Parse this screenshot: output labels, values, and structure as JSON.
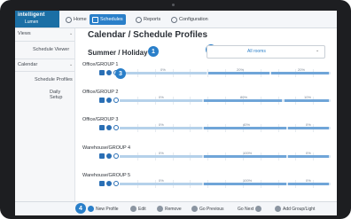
{
  "app": {
    "logo_line1": "intelligent",
    "logo_line2": "Lumen"
  },
  "nav": [
    {
      "label": "Home",
      "icon": "home-icon",
      "active": false
    },
    {
      "label": "Schedules",
      "icon": "calendar-icon",
      "active": true
    },
    {
      "label": "Reports",
      "icon": "reports-icon",
      "active": false
    },
    {
      "label": "Configuration",
      "icon": "gear-icon",
      "active": false
    }
  ],
  "sidebar": {
    "views_label": "Views",
    "schedule_viewer": "Schedule Viewer",
    "calendar_label": "Calendar",
    "schedule_profiles": "Schedule Profiles",
    "daily_setup": "Daily Setup"
  },
  "main": {
    "title": "Calendar / Schedule Profiles",
    "subtitle": "Summer / Holiday",
    "room_select": "All rooms",
    "callouts": [
      "1",
      "2",
      "3",
      "4"
    ]
  },
  "groups": [
    {
      "name": "Office/GROUP 1",
      "segments": [
        {
          "start": 0.0,
          "end": 0.42,
          "level": "0%"
        },
        {
          "start": 0.42,
          "end": 0.72,
          "level": "20%"
        },
        {
          "start": 0.72,
          "end": 1.0,
          "level": "20%"
        }
      ]
    },
    {
      "name": "Office/GROUP 2",
      "segments": [
        {
          "start": 0.0,
          "end": 0.4,
          "level": "0%"
        },
        {
          "start": 0.4,
          "end": 0.78,
          "level": "80%"
        },
        {
          "start": 0.78,
          "end": 1.0,
          "level": "10%"
        }
      ]
    },
    {
      "name": "Office/GROUP 3",
      "segments": [
        {
          "start": 0.0,
          "end": 0.4,
          "level": "0%"
        },
        {
          "start": 0.4,
          "end": 0.8,
          "level": "40%"
        },
        {
          "start": 0.8,
          "end": 1.0,
          "level": "0%"
        }
      ]
    },
    {
      "name": "Warehouse/GROUP 4",
      "segments": [
        {
          "start": 0.0,
          "end": 0.4,
          "level": "0%"
        },
        {
          "start": 0.4,
          "end": 0.8,
          "level": "100%"
        },
        {
          "start": 0.8,
          "end": 1.0,
          "level": "0%"
        }
      ]
    },
    {
      "name": "Warehouse/GROUP 5",
      "segments": [
        {
          "start": 0.0,
          "end": 0.4,
          "level": "0%"
        },
        {
          "start": 0.4,
          "end": 0.8,
          "level": "100%"
        },
        {
          "start": 0.8,
          "end": 1.0,
          "level": "0%"
        }
      ]
    }
  ],
  "bottom": {
    "new_profile": "New Profile",
    "edit": "Edit",
    "remove": "Remove",
    "go_previous": "Go Previous",
    "go_next": "Go Next",
    "add_group_light": "Add Group/Light"
  },
  "colors": {
    "accent": "#2a7fc9",
    "bar": "#6fa5d8",
    "track": "#dbe8f4",
    "device": "#1d1e21"
  }
}
